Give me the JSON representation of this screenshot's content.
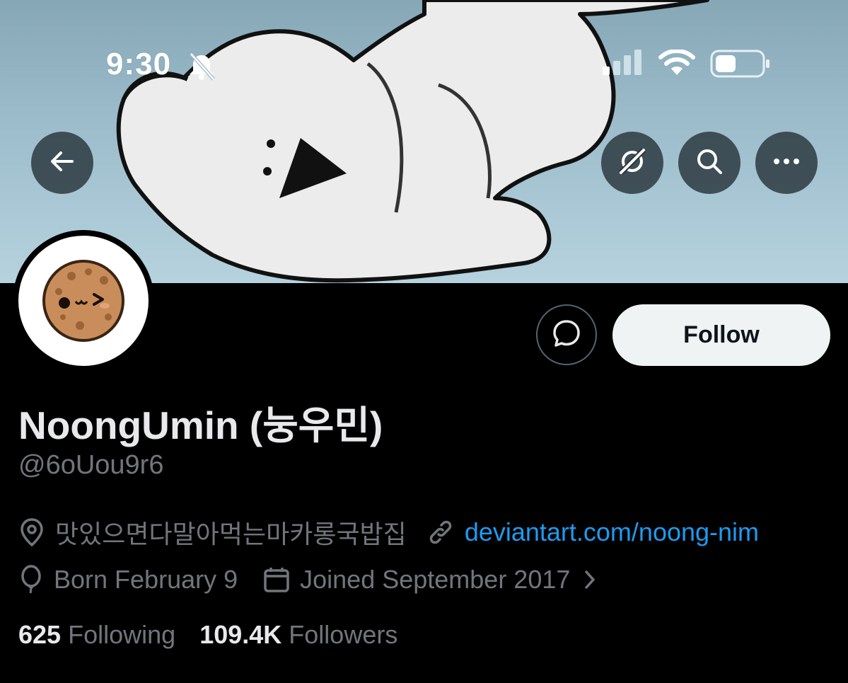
{
  "status_bar": {
    "time": "9:30"
  },
  "banner": {
    "icons": [
      "back-arrow-icon",
      "grok-icon",
      "search-icon",
      "more-icon"
    ]
  },
  "profile": {
    "display_name": "NoongUmin (눙우민)",
    "handle": "@6oUou9r6",
    "location": "맛있으면다말아먹는마카롱국밥집",
    "website": "deviantart.com/noong-nim",
    "born": "Born February 9",
    "joined": "Joined September 2017"
  },
  "actions": {
    "follow_label": "Follow"
  },
  "stats": {
    "following_count": "625",
    "following_label": "Following",
    "followers_count": "109.4K",
    "followers_label": "Followers"
  },
  "colors": {
    "background": "#000000",
    "link": "#1d9bf0",
    "muted": "#71767b",
    "text": "#e7e9ea",
    "follow_bg": "#eff3f4"
  }
}
